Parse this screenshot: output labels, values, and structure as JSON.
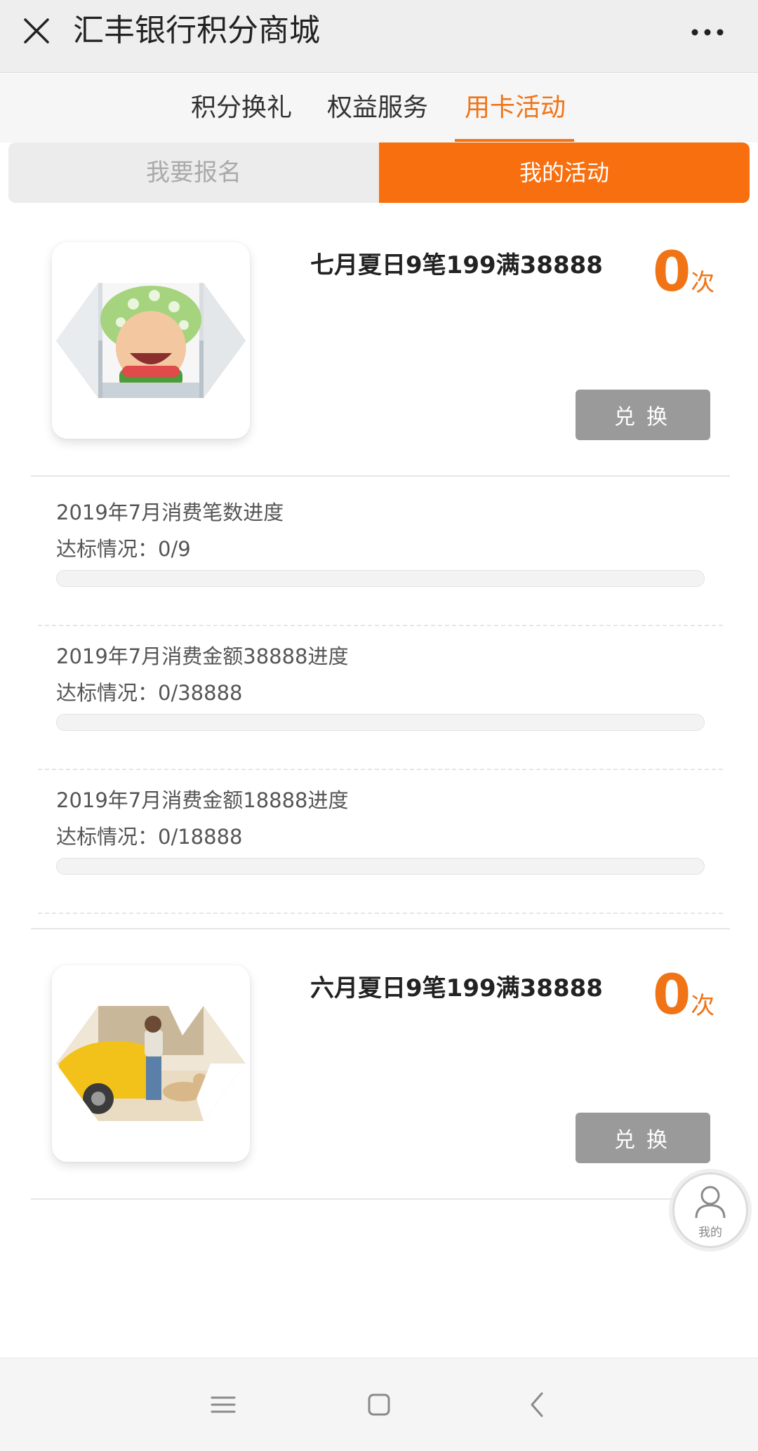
{
  "header": {
    "title": "汇丰银行积分商城",
    "close_icon": "close-icon",
    "more_icon": "more-dots-icon"
  },
  "tabs": [
    {
      "label": "积分换礼",
      "active": false
    },
    {
      "label": "权益服务",
      "active": false
    },
    {
      "label": "用卡活动",
      "active": true
    }
  ],
  "segment": {
    "left_label": "我要报名",
    "right_label": "我的活动",
    "selected": "我的活动"
  },
  "activities": [
    {
      "title": "七月夏日9笔199满38888",
      "count": "0",
      "count_unit": "次",
      "button_label": "兑换",
      "progress": [
        {
          "label": "2019年7月消费笔数进度",
          "status": "达标情况：0/9",
          "current": 0,
          "target": 9
        },
        {
          "label": "2019年7月消费金额38888进度",
          "status": "达标情况：0/38888",
          "current": 0,
          "target": 38888
        },
        {
          "label": "2019年7月消费金额18888进度",
          "status": "达标情况：0/18888",
          "current": 0,
          "target": 18888
        }
      ]
    },
    {
      "title": "六月夏日9笔199满38888",
      "count": "0",
      "count_unit": "次",
      "button_label": "兑换"
    }
  ],
  "fab": {
    "label": "我的",
    "icon": "user-icon"
  },
  "nav": {
    "icons": [
      "menu-icon",
      "home-square-icon",
      "back-icon"
    ]
  },
  "colors": {
    "accent": "#f76f0e",
    "button_gray": "#9a9a9a"
  }
}
